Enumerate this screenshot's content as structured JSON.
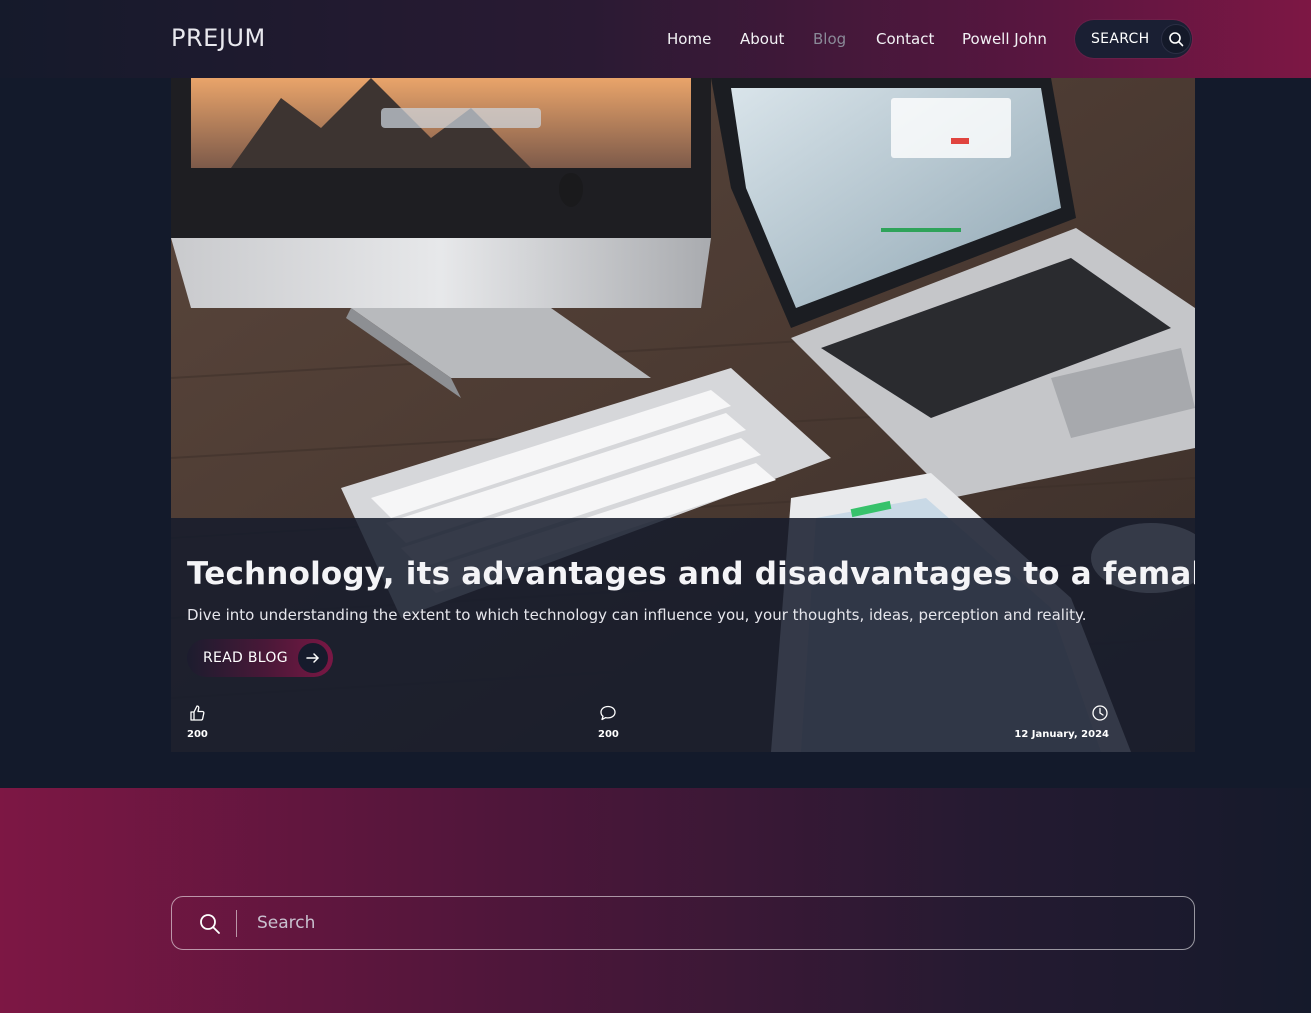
{
  "brand": {
    "logo": "PREJUM"
  },
  "nav": {
    "items": [
      {
        "label": "Home",
        "active": false
      },
      {
        "label": "About",
        "active": false
      },
      {
        "label": "Blog",
        "active": true
      },
      {
        "label": "Contact",
        "active": false
      },
      {
        "label": "Powell John",
        "active": false
      }
    ],
    "search_label": "SEARCH",
    "search_icon": "search-icon"
  },
  "hero": {
    "title": "Technology, its advantages and disadvantages to a female",
    "description": "Dive into understanding the extent to which technology can influence you, your thoughts, ideas, perception and reality.",
    "button_label": "READ BLOG",
    "button_icon": "arrow-right-icon",
    "stats": {
      "likes": {
        "icon": "thumbs-up-icon",
        "value": "200"
      },
      "comments": {
        "icon": "comment-icon",
        "value": "200"
      },
      "date": {
        "icon": "clock-icon",
        "value": "12 January, 2024"
      }
    }
  },
  "search_section": {
    "placeholder": "Search",
    "icon": "search-icon"
  },
  "colors": {
    "accent": "#7d1744",
    "background": "#131a2b",
    "nav_active": "#8a8a98"
  }
}
